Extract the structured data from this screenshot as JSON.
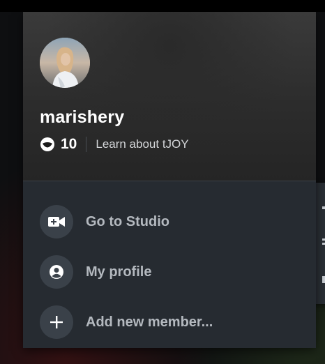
{
  "profile": {
    "username": "marishery",
    "coin_count": "10",
    "learn_link": "Learn about tJOY"
  },
  "menu": {
    "items": [
      {
        "label": "Go to Studio",
        "icon": "video-camera-plus-icon"
      },
      {
        "label": "My profile",
        "icon": "user-circle-icon"
      },
      {
        "label": "Add new member...",
        "icon": "plus-icon"
      }
    ]
  },
  "colors": {
    "menu_bg": "#262b31",
    "icon_circle_bg": "#3a4149",
    "menu_text": "#b4b9bf",
    "header_text": "#ffffff"
  }
}
